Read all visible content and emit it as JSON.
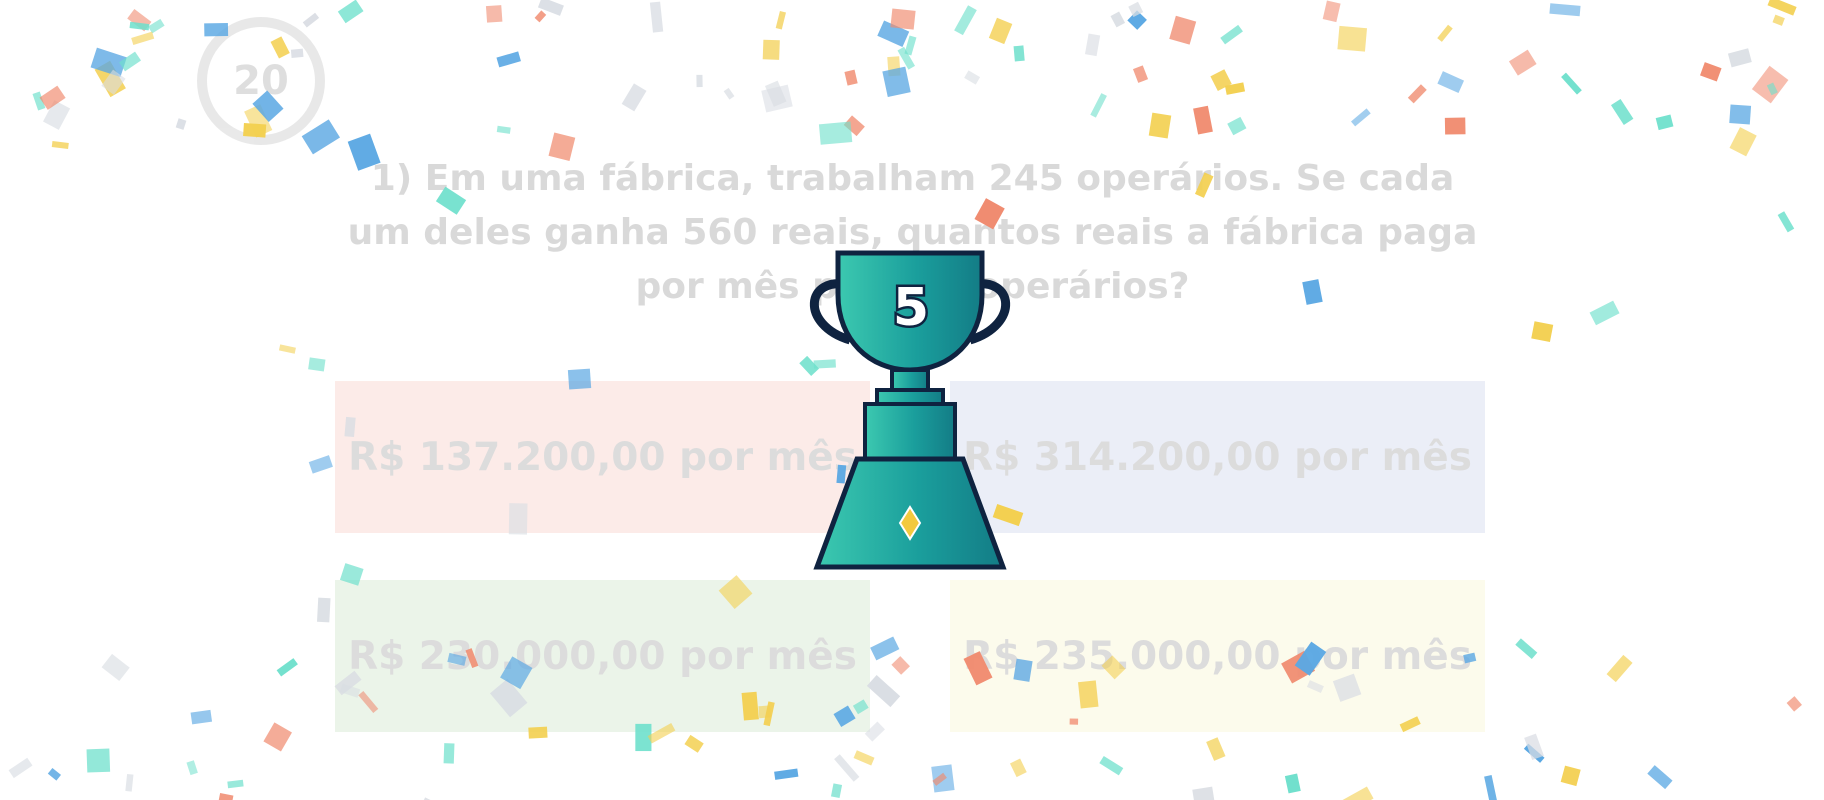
{
  "timer": {
    "value": "20"
  },
  "question": {
    "text": "1) Em uma fábrica, trabalham 245 operários. Se cada um deles ganha 560 reais, quantos reais a fábrica paga por mês para os operários?"
  },
  "answers": [
    {
      "label": "R$ 137.200,00 por mês",
      "color": "#f4a79b"
    },
    {
      "label": "R$ 314.200,00 por mês",
      "color": "#a9b3dc"
    },
    {
      "label": "R$ 230.000,00 por mês",
      "color": "#a8cf9d"
    },
    {
      "label": "R$ 235.000,00 por mês",
      "color": "#f6eeaa"
    }
  ],
  "trophy": {
    "number": "5",
    "icon": "trophy-icon",
    "colors": {
      "body": "#1a9e9c",
      "outline": "#0f2340",
      "gem": "#f3c93e"
    }
  },
  "confetti_colors": [
    "#f3cf4f",
    "#6fe0cc",
    "#f08a6e",
    "#5ba8e3",
    "#d9dde3"
  ]
}
